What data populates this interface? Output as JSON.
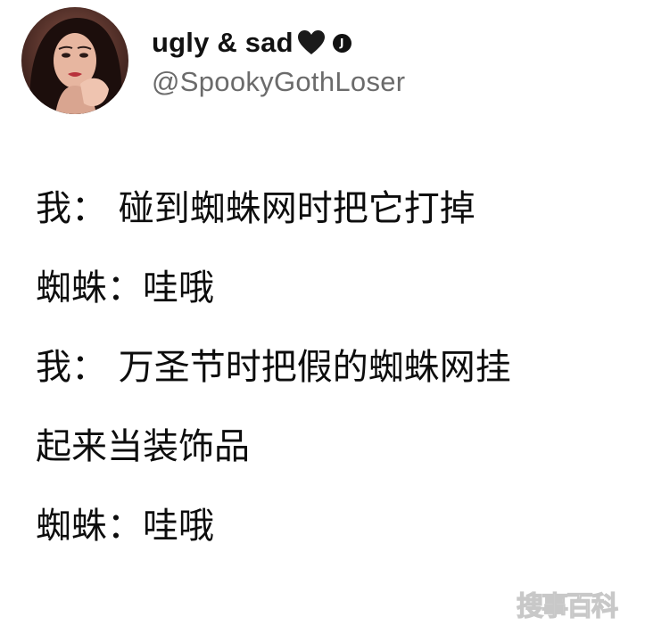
{
  "tweet": {
    "display_name": "ugly & sad",
    "handle": "@SpookyGothLoser",
    "badge_letter": "J",
    "heart_icon": "black-heart-icon",
    "lines": [
      "我： 碰到蜘蛛网时把它打掉",
      "蜘蛛：哇哦",
      "我： 万圣节时把假的蜘蛛网挂",
      "起来当装饰品",
      "蜘蛛：哇哦"
    ]
  },
  "watermark": {
    "text": "搜事百科"
  },
  "colors": {
    "background": "#ffffff",
    "text": "#0d0d0d",
    "handle": "#6b6b6b",
    "heart": "#1a1a1a"
  }
}
